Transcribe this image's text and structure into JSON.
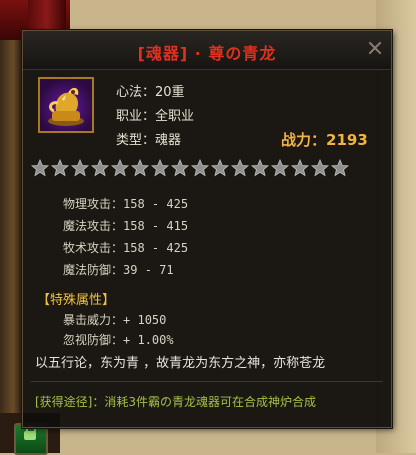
{
  "item": {
    "title": "[魂器] · 尊の青龙",
    "icon": "golden-dragon-statue-icon",
    "props": [
      {
        "label": "心法：20重"
      },
      {
        "label": "职业：全职业"
      },
      {
        "label": "类型：魂器"
      }
    ],
    "power_label": "战力：",
    "power_value": "2193",
    "stars": {
      "total": 16,
      "filled": 0
    },
    "stats": [
      {
        "name": "物理攻击：",
        "value": "158 - 425"
      },
      {
        "name": "魔法攻击：",
        "value": "158 - 415"
      },
      {
        "name": "牧术攻击：",
        "value": "158 - 425"
      },
      {
        "name": "魔法防御：",
        "value": "39 - 71"
      }
    ],
    "special_title": "【特殊属性】",
    "special_stats": [
      {
        "name": "暴击威力：",
        "value": "+ 1050"
      },
      {
        "name": "忽视防御：",
        "value": "+ 1.00%"
      }
    ],
    "description": "以五行论，东为青 ，故青龙为东方之神，亦称苍龙",
    "source": "[获得途径]：消耗3件霸の青龙魂器可在合成神炉合成"
  },
  "colors": {
    "title": "#e0301e",
    "power": "#f2b340",
    "section": "#f0c040",
    "source": "#a4c048"
  }
}
